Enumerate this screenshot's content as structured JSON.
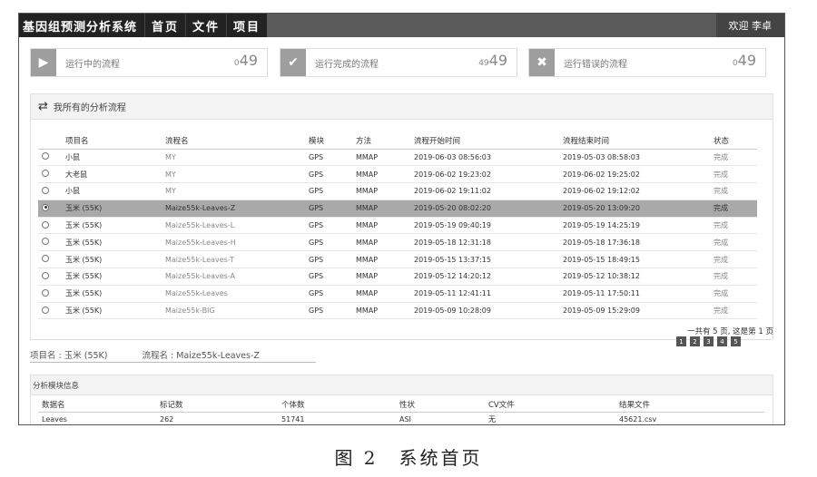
{
  "topbar": {
    "brand": "基因组预测分析系统",
    "nav": [
      "首页",
      "文件",
      "项目"
    ],
    "welcome": "欢迎 李卓"
  },
  "stats": [
    {
      "label": "运行中的流程",
      "prefix": "0",
      "count": "49",
      "icon": "play-icon"
    },
    {
      "label": "运行完成的流程",
      "prefix": "49",
      "count": "49",
      "icon": "check-icon"
    },
    {
      "label": "运行错误的流程",
      "prefix": "0",
      "count": "49",
      "icon": "close-icon"
    }
  ],
  "flows_panel": {
    "title": "我所有的分析流程",
    "columns": [
      "项目名",
      "流程名",
      "模块",
      "方法",
      "流程开始时间",
      "流程结束时间",
      "状态"
    ],
    "rows": [
      {
        "project": "小鼠",
        "flow": "MY",
        "module": "GPS",
        "method": "MMAP",
        "start": "2019-06-03 08:56:03",
        "end": "2019-05-03 08:58:03",
        "status": "完成",
        "selected": false
      },
      {
        "project": "大老鼠",
        "flow": "MY",
        "module": "GPS",
        "method": "MMAP",
        "start": "2019-06-02 19:23:02",
        "end": "2019-06-02 19:25:02",
        "status": "完成",
        "selected": false
      },
      {
        "project": "小鼠",
        "flow": "MY",
        "module": "GPS",
        "method": "MMAP",
        "start": "2019-06-02 19:11:02",
        "end": "2019-06-02 19:12:02",
        "status": "完成",
        "selected": false
      },
      {
        "project": "玉米 (55K)",
        "flow": "Maize55k-Leaves-Z",
        "module": "GPS",
        "method": "MMAP",
        "start": "2019-05-20 08:02:20",
        "end": "2019-05-20 13:09:20",
        "status": "完成",
        "selected": true
      },
      {
        "project": "玉米 (55K)",
        "flow": "Maize55k-Leaves-L",
        "module": "GPS",
        "method": "MMAP",
        "start": "2019-05-19 09:40:19",
        "end": "2019-05-19 14:25:19",
        "status": "完成",
        "selected": false
      },
      {
        "project": "玉米 (55K)",
        "flow": "Maize55k-Leaves-H",
        "module": "GPS",
        "method": "MMAP",
        "start": "2019-05-18 12:31:18",
        "end": "2019-05-18 17:36:18",
        "status": "完成",
        "selected": false
      },
      {
        "project": "玉米 (55K)",
        "flow": "Maize55k-Leaves-T",
        "module": "GPS",
        "method": "MMAP",
        "start": "2019-05-15 13:37:15",
        "end": "2019-05-15 18:49:15",
        "status": "完成",
        "selected": false
      },
      {
        "project": "玉米 (55K)",
        "flow": "Maize55k-Leaves-A",
        "module": "GPS",
        "method": "MMAP",
        "start": "2019-05-12 14:20:12",
        "end": "2019-05-12 10:38:12",
        "status": "完成",
        "selected": false
      },
      {
        "project": "玉米 (55K)",
        "flow": "Maize55k-Leaves",
        "module": "GPS",
        "method": "MMAP",
        "start": "2019-05-11 12:41:11",
        "end": "2019-05-11 17:50:11",
        "status": "完成",
        "selected": false
      },
      {
        "project": "玉米 (55K)",
        "flow": "Maize55k-BIG",
        "module": "GPS",
        "method": "MMAP",
        "start": "2019-05-09 10:28:09",
        "end": "2019-05-09 15:29:09",
        "status": "完成",
        "selected": false
      }
    ],
    "pager_text": "一共有 5 页, 这是第 1 页",
    "pages": [
      "1",
      "2",
      "3",
      "4",
      "5"
    ]
  },
  "selection": {
    "project_label": "项目名 : 玉米 (55K)",
    "flow_label": "流程名 : Maize55k-Leaves-Z"
  },
  "modules_panel": {
    "title": "分析模块信息",
    "columns": [
      "数据名",
      "标记数",
      "个体数",
      "性状",
      "CV文件",
      "结果文件"
    ],
    "rows": [
      {
        "data": "Leaves",
        "markers": "262",
        "individuals": "51741",
        "trait": "ASI",
        "cv": "无",
        "result": "45621.csv"
      }
    ]
  },
  "caption": "图 2　系统首页"
}
